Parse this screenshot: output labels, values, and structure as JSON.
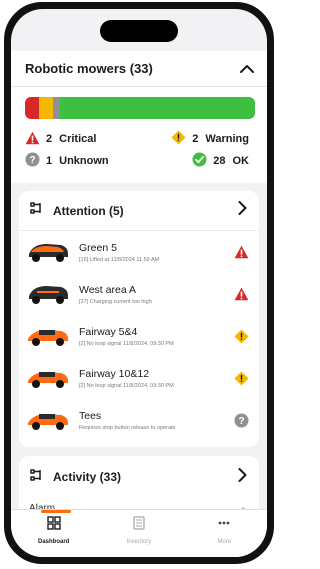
{
  "header": {
    "title": "Robotic mowers (33)"
  },
  "summary": {
    "bar_segments": [
      {
        "status": "critical",
        "count": 2,
        "color": "#d62828"
      },
      {
        "status": "warning",
        "count": 2,
        "color": "#f5b800"
      },
      {
        "status": "unknown",
        "count": 1,
        "color": "#8f8f94"
      },
      {
        "status": "ok",
        "count": 28,
        "color": "#3fbf3f"
      }
    ],
    "critical": {
      "count": "2",
      "label": "Critical"
    },
    "warning": {
      "count": "2",
      "label": "Warning"
    },
    "unknown": {
      "count": "1",
      "label": "Unknown"
    },
    "ok": {
      "count": "28",
      "label": "OK"
    }
  },
  "attention": {
    "title": "Attention (5)",
    "items": [
      {
        "name": "Green 5",
        "detail": "[16] Lifted at 11/8/2024 11:59 AM",
        "severity": "critical",
        "icon": "critical-icon"
      },
      {
        "name": "West area A",
        "detail": "[37] Charging current too high",
        "severity": "critical",
        "icon": "critical-icon"
      },
      {
        "name": "Fairway 5&4",
        "detail": "[2] No loop signal 11/8/2024, 09:30 PM",
        "severity": "warning",
        "icon": "warning-icon"
      },
      {
        "name": "Fairway 10&12",
        "detail": "[2] No loop signal 11/8/2024, 09:30 PM",
        "severity": "warning",
        "icon": "warning-icon"
      },
      {
        "name": "Tees",
        "detail": "Requires stop button release to operate",
        "severity": "unknown",
        "icon": "unknown-icon"
      }
    ]
  },
  "activity": {
    "title": "Activity (33)",
    "rows": [
      {
        "label": "Alarm",
        "value": "-"
      }
    ]
  },
  "tabs": [
    {
      "label": "Dashboard",
      "icon": "dashboard-icon",
      "active": true
    },
    {
      "label": "Inventory",
      "icon": "inventory-icon",
      "active": false
    },
    {
      "label": "More",
      "icon": "more-icon",
      "active": false
    }
  ],
  "colors": {
    "critical": "#d62828",
    "warning": "#f5b800",
    "unknown": "#8f8f94",
    "ok": "#3fbf3f",
    "accent": "#ff6a13"
  }
}
